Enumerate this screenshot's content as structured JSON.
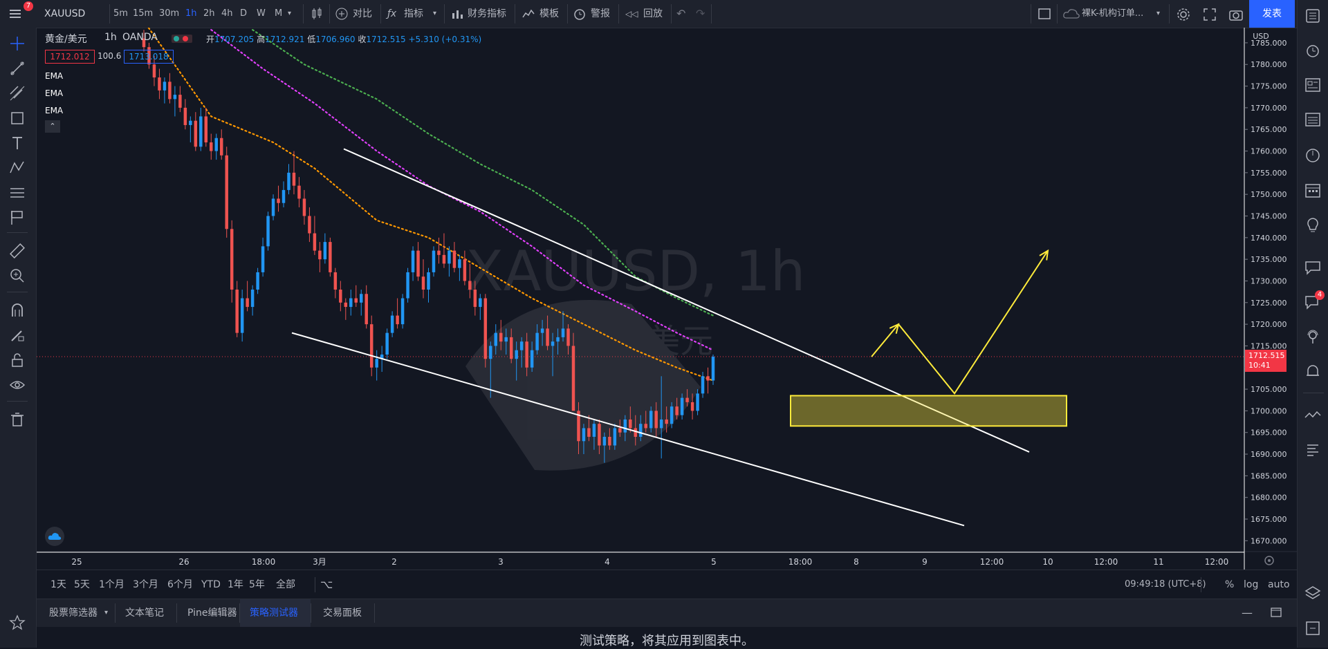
{
  "toolbar": {
    "symbol": "XAUUSD",
    "notifications": "7",
    "intervals": [
      "5m",
      "15m",
      "30m",
      "1h",
      "2h",
      "4h",
      "D",
      "W",
      "M"
    ],
    "active_interval": "1h",
    "compare": "对比",
    "indicators": "指标",
    "financials": "财务指标",
    "templates": "模板",
    "alert": "警报",
    "replay": "回放",
    "layout_name": "裸K-机构订单...",
    "publish": "发表"
  },
  "legend": {
    "title": "黄金/美元",
    "interval": "1h",
    "source": "OANDA",
    "open_label": "开",
    "open": "1707.205",
    "high_label": "高",
    "high": "1712.921",
    "low_label": "低",
    "low": "1706.960",
    "close_label": "收",
    "close": "1712.515",
    "change": "+5.310 (+0.31%)",
    "bid": "1712.012",
    "spread": "100.6",
    "ask": "1713.018",
    "studies": [
      "EMA",
      "EMA",
      "EMA"
    ]
  },
  "watermark": {
    "line1": "XAUUSD, 1h",
    "line2": "黄金/美元"
  },
  "price_axis": {
    "currency": "USD",
    "current_price": "1712.515",
    "countdown": "10:41",
    "colors": {
      "up": "#2196f3",
      "down": "#ef5350",
      "current": "#f23645"
    }
  },
  "chart_data": {
    "type": "candlestick",
    "symbol": "XAUUSD",
    "y_ticks": [
      "1785.000",
      "1780.000",
      "1775.000",
      "1770.000",
      "1765.000",
      "1760.000",
      "1755.000",
      "1750.000",
      "1745.000",
      "1740.000",
      "1735.000",
      "1730.000",
      "1725.000",
      "1720.000",
      "1715.000",
      "1710.000",
      "1705.000",
      "1700.000",
      "1695.000",
      "1690.000",
      "1685.000",
      "1680.000",
      "1675.000",
      "1670.000"
    ],
    "ylim": [
      1667.5,
      1788.5
    ],
    "x_ticks": [
      "25",
      "26",
      "18:00",
      "3月",
      "2",
      "3",
      "4",
      "5",
      "18:00",
      "8",
      "9",
      "12:00",
      "10",
      "12:00",
      "11",
      "12:00"
    ],
    "candles": [
      [
        1,
        1786,
        1788,
        1783,
        1784
      ],
      [
        2,
        1784,
        1785,
        1779,
        1780
      ],
      [
        3,
        1780,
        1782,
        1775,
        1777
      ],
      [
        4,
        1777,
        1779,
        1772,
        1774
      ],
      [
        5,
        1774,
        1777,
        1771,
        1776
      ],
      [
        6,
        1776,
        1778,
        1771,
        1772
      ],
      [
        7,
        1772,
        1775,
        1768,
        1773
      ],
      [
        8,
        1773,
        1775,
        1769,
        1770
      ],
      [
        9,
        1770,
        1772,
        1765,
        1766
      ],
      [
        10,
        1766,
        1768,
        1762,
        1767
      ],
      [
        11,
        1767,
        1769,
        1760,
        1761
      ],
      [
        12,
        1761,
        1770,
        1760,
        1768
      ],
      [
        13,
        1768,
        1770,
        1761,
        1762
      ],
      [
        14,
        1762,
        1764,
        1758,
        1760
      ],
      [
        15,
        1760,
        1764,
        1758,
        1763
      ],
      [
        16,
        1763,
        1765,
        1758,
        1759
      ],
      [
        17,
        1759,
        1761,
        1740,
        1742
      ],
      [
        18,
        1742,
        1744,
        1725,
        1728
      ],
      [
        19,
        1728,
        1730,
        1717,
        1718
      ],
      [
        20,
        1718,
        1728,
        1716,
        1726
      ],
      [
        21,
        1726,
        1730,
        1723,
        1724
      ],
      [
        22,
        1724,
        1729,
        1722,
        1728
      ],
      [
        23,
        1728,
        1733,
        1727,
        1732
      ],
      [
        24,
        1732,
        1740,
        1731,
        1738
      ],
      [
        25,
        1738,
        1746,
        1737,
        1745
      ],
      [
        26,
        1745,
        1750,
        1744,
        1749
      ],
      [
        27,
        1749,
        1752,
        1746,
        1748
      ],
      [
        28,
        1748,
        1753,
        1747,
        1751
      ],
      [
        29,
        1751,
        1757,
        1750,
        1755
      ],
      [
        30,
        1755,
        1760,
        1750,
        1752
      ],
      [
        31,
        1752,
        1754,
        1747,
        1749
      ],
      [
        32,
        1749,
        1751,
        1743,
        1745
      ],
      [
        33,
        1745,
        1747,
        1739,
        1741
      ],
      [
        34,
        1741,
        1745,
        1736,
        1737
      ],
      [
        35,
        1737,
        1739,
        1732,
        1735
      ],
      [
        36,
        1735,
        1741,
        1734,
        1739
      ],
      [
        37,
        1739,
        1740,
        1731,
        1732
      ],
      [
        38,
        1732,
        1733,
        1726,
        1728
      ],
      [
        39,
        1728,
        1730,
        1723,
        1725
      ],
      [
        40,
        1725,
        1726,
        1721,
        1724
      ],
      [
        41,
        1724,
        1728,
        1722,
        1726
      ],
      [
        42,
        1726,
        1729,
        1724,
        1725
      ],
      [
        43,
        1725,
        1728,
        1722,
        1727
      ],
      [
        44,
        1727,
        1729,
        1719,
        1720
      ],
      [
        45,
        1720,
        1722,
        1708,
        1710
      ],
      [
        46,
        1710,
        1714,
        1707,
        1712
      ],
      [
        47,
        1712,
        1715,
        1709,
        1713
      ],
      [
        48,
        1713,
        1719,
        1712,
        1718
      ],
      [
        49,
        1718,
        1723,
        1717,
        1722
      ],
      [
        50,
        1722,
        1726,
        1719,
        1720
      ],
      [
        51,
        1720,
        1727,
        1719,
        1726
      ],
      [
        52,
        1726,
        1733,
        1725,
        1732
      ],
      [
        53,
        1732,
        1738,
        1730,
        1737
      ],
      [
        54,
        1737,
        1739,
        1730,
        1731
      ],
      [
        55,
        1731,
        1735,
        1726,
        1728
      ],
      [
        56,
        1728,
        1733,
        1725,
        1732
      ],
      [
        57,
        1732,
        1738,
        1731,
        1737
      ],
      [
        58,
        1737,
        1740,
        1734,
        1736
      ],
      [
        59,
        1736,
        1741,
        1733,
        1734
      ],
      [
        60,
        1734,
        1738,
        1731,
        1737
      ],
      [
        61,
        1737,
        1739,
        1732,
        1733
      ],
      [
        62,
        1733,
        1736,
        1730,
        1735
      ],
      [
        63,
        1735,
        1737,
        1729,
        1730
      ],
      [
        64,
        1730,
        1734,
        1726,
        1728
      ],
      [
        65,
        1728,
        1730,
        1722,
        1724
      ],
      [
        66,
        1724,
        1727,
        1721,
        1726
      ],
      [
        67,
        1726,
        1727,
        1710,
        1712
      ],
      [
        68,
        1712,
        1716,
        1703,
        1715
      ],
      [
        69,
        1715,
        1720,
        1713,
        1718
      ],
      [
        70,
        1718,
        1721,
        1714,
        1716
      ],
      [
        71,
        1716,
        1719,
        1713,
        1717
      ],
      [
        72,
        1717,
        1719,
        1711,
        1712
      ],
      [
        73,
        1712,
        1716,
        1707,
        1714
      ],
      [
        74,
        1714,
        1717,
        1710,
        1716
      ],
      [
        75,
        1716,
        1718,
        1708,
        1710
      ],
      [
        76,
        1710,
        1716,
        1709,
        1714
      ],
      [
        77,
        1714,
        1720,
        1713,
        1718
      ],
      [
        78,
        1718,
        1721,
        1715,
        1719
      ],
      [
        79,
        1719,
        1722,
        1714,
        1715
      ],
      [
        80,
        1715,
        1718,
        1708,
        1716
      ],
      [
        81,
        1716,
        1719,
        1713,
        1717
      ],
      [
        82,
        1717,
        1723,
        1716,
        1719
      ],
      [
        83,
        1719,
        1720,
        1713,
        1715
      ],
      [
        84,
        1715,
        1718,
        1707,
        1700
      ],
      [
        85,
        1700,
        1702,
        1690,
        1693
      ],
      [
        86,
        1693,
        1697,
        1690,
        1696
      ],
      [
        87,
        1696,
        1699,
        1693,
        1694
      ],
      [
        88,
        1694,
        1698,
        1691,
        1697
      ],
      [
        89,
        1697,
        1698,
        1690,
        1692
      ],
      [
        90,
        1692,
        1695,
        1688,
        1694
      ],
      [
        91,
        1694,
        1696,
        1691,
        1692
      ],
      [
        92,
        1692,
        1697,
        1691,
        1696
      ],
      [
        93,
        1696,
        1698,
        1694,
        1695
      ],
      [
        94,
        1695,
        1699,
        1693,
        1698
      ],
      [
        95,
        1698,
        1701,
        1695,
        1696
      ],
      [
        96,
        1696,
        1699,
        1692,
        1694
      ],
      [
        97,
        1694,
        1699,
        1693,
        1697
      ],
      [
        98,
        1697,
        1700,
        1695,
        1696
      ],
      [
        99,
        1696,
        1701,
        1695,
        1700
      ],
      [
        100,
        1700,
        1702,
        1694,
        1696
      ],
      [
        101,
        1696,
        1708,
        1689,
        1698
      ],
      [
        102,
        1698,
        1701,
        1695,
        1697
      ],
      [
        103,
        1697,
        1702,
        1696,
        1701
      ],
      [
        104,
        1701,
        1703,
        1698,
        1699
      ],
      [
        105,
        1699,
        1704,
        1698,
        1703
      ],
      [
        106,
        1703,
        1705,
        1701,
        1702
      ],
      [
        107,
        1702,
        1704,
        1698,
        1700
      ],
      [
        108,
        1700,
        1705,
        1699,
        1704
      ],
      [
        109,
        1704,
        1709,
        1703,
        1708
      ],
      [
        110,
        1708,
        1710,
        1704,
        1707
      ],
      [
        111,
        1707,
        1713,
        1706,
        1712.5
      ]
    ],
    "ema_series": [
      {
        "color": "#ff9800",
        "points": [
          [
            1,
            1790
          ],
          [
            14,
            1768
          ],
          [
            26,
            1762
          ],
          [
            34,
            1756
          ],
          [
            46,
            1744
          ],
          [
            56,
            1740
          ],
          [
            66,
            1733
          ],
          [
            76,
            1726
          ],
          [
            86,
            1720
          ],
          [
            96,
            1714
          ],
          [
            104,
            1710
          ],
          [
            111,
            1707
          ]
        ]
      },
      {
        "color": "#e040fb",
        "points": [
          [
            14,
            1788
          ],
          [
            24,
            1779
          ],
          [
            34,
            1771
          ],
          [
            46,
            1760
          ],
          [
            56,
            1752
          ],
          [
            66,
            1746
          ],
          [
            76,
            1738
          ],
          [
            86,
            1729
          ],
          [
            96,
            1723
          ],
          [
            104,
            1718
          ],
          [
            111,
            1714
          ]
        ]
      },
      {
        "color": "#4caf50",
        "points": [
          [
            22,
            1788
          ],
          [
            32,
            1780
          ],
          [
            46,
            1772
          ],
          [
            56,
            1764
          ],
          [
            66,
            1757
          ],
          [
            76,
            1751
          ],
          [
            86,
            1743
          ],
          [
            96,
            1731
          ],
          [
            104,
            1726
          ],
          [
            111,
            1722
          ]
        ]
      }
    ],
    "annotations": {
      "trendline_upper": [
        [
          1760.5
        ],
        [
          1690.5
        ]
      ],
      "trendline_lower": [
        [
          1718
        ],
        [
          1673.5
        ]
      ],
      "zone": [
        1696.5,
        1703.5
      ],
      "projection": [
        [
          1712.5
        ],
        [
          1720
        ],
        [
          1704
        ],
        [
          1737
        ]
      ]
    }
  },
  "timeframes": [
    "1天",
    "5天",
    "1个月",
    "3个月",
    "6个月",
    "YTD",
    "1年",
    "5年",
    "全部"
  ],
  "time_readout": "09:49:18 (UTC+8)",
  "scale_options": [
    "%",
    "log",
    "auto"
  ],
  "panel_tabs": [
    "股票筛选器",
    "文本笔记",
    "Pine编辑器",
    "策略测试器",
    "交易面板"
  ],
  "active_panel": "策略测试器",
  "panel_message": "测试策略，将其应用到图表中。",
  "right_badge": "4"
}
